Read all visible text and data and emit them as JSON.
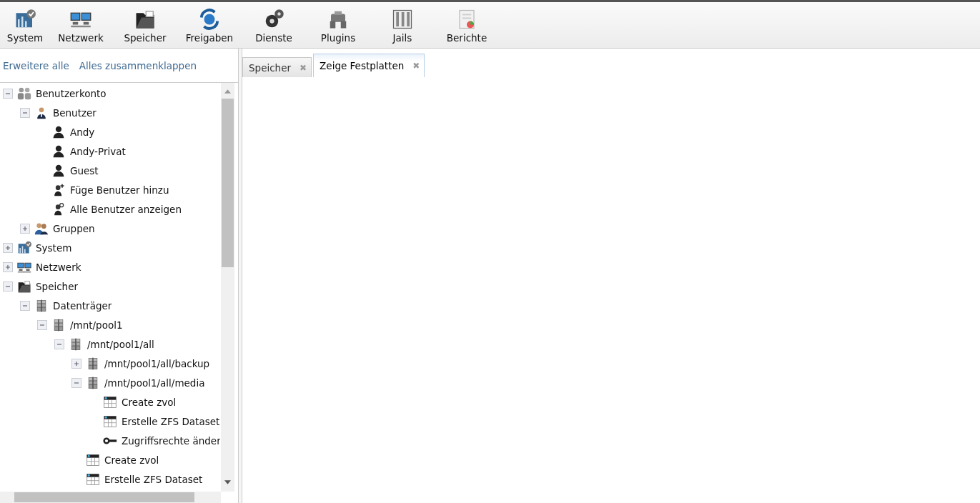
{
  "toolbar": [
    {
      "label": "System",
      "kind": "system"
    },
    {
      "label": "Netzwerk",
      "kind": "network"
    },
    {
      "label": "Speicher",
      "kind": "storage"
    },
    {
      "label": "Freigaben",
      "kind": "shares"
    },
    {
      "label": "Dienste",
      "kind": "services"
    },
    {
      "label": "Plugins",
      "kind": "plugins"
    },
    {
      "label": "Jails",
      "kind": "jails"
    },
    {
      "label": "Berichte",
      "kind": "reports"
    }
  ],
  "tree_actions": [
    "Erweitere alle",
    "Alles zusammenklappen"
  ],
  "tabs": [
    {
      "label": "Speicher",
      "selected": false,
      "close": "✖"
    },
    {
      "label": "Zeige Festplatten",
      "selected": true,
      "close": "✖"
    }
  ],
  "tree": [
    {
      "label": "Benutzerkonto",
      "kind": "users",
      "expanded": true,
      "children": [
        {
          "label": "Benutzer",
          "kind": "user",
          "expanded": true,
          "children": [
            {
              "label": "Andy",
              "kind": "person"
            },
            {
              "label": "Andy-Privat",
              "kind": "person"
            },
            {
              "label": "Guest",
              "kind": "person"
            },
            {
              "label": "Füge Benutzer hinzu",
              "kind": "useradd"
            },
            {
              "label": "Alle Benutzer anzeigen",
              "kind": "userview"
            }
          ]
        },
        {
          "label": "Gruppen",
          "kind": "group",
          "expanded": false
        }
      ]
    },
    {
      "label": "System",
      "kind": "system",
      "expanded": false
    },
    {
      "label": "Netzwerk",
      "kind": "network",
      "expanded": false
    },
    {
      "label": "Speicher",
      "kind": "storage",
      "expanded": true,
      "children": [
        {
          "label": "Datenträger",
          "kind": "disk",
          "expanded": true,
          "children": [
            {
              "label": "/mnt/pool1",
              "kind": "disk",
              "expanded": true,
              "children": [
                {
                  "label": "/mnt/pool1/all",
                  "kind": "disk",
                  "expanded": true,
                  "children": [
                    {
                      "label": "/mnt/pool1/all/backup",
                      "kind": "disk",
                      "expanded": false
                    },
                    {
                      "label": "/mnt/pool1/all/media",
                      "kind": "disk",
                      "expanded": true,
                      "children": [
                        {
                          "label": "Create zvol",
                          "kind": "grid"
                        },
                        {
                          "label": "Erstelle ZFS Dataset",
                          "kind": "grid"
                        },
                        {
                          "label": "Zugriffsrechte änder",
                          "kind": "key"
                        }
                      ]
                    },
                    {
                      "label": "Create zvol",
                      "kind": "grid"
                    },
                    {
                      "label": "Erstelle ZFS Dataset",
                      "kind": "grid"
                    }
                  ]
                }
              ]
            }
          ]
        }
      ]
    }
  ]
}
